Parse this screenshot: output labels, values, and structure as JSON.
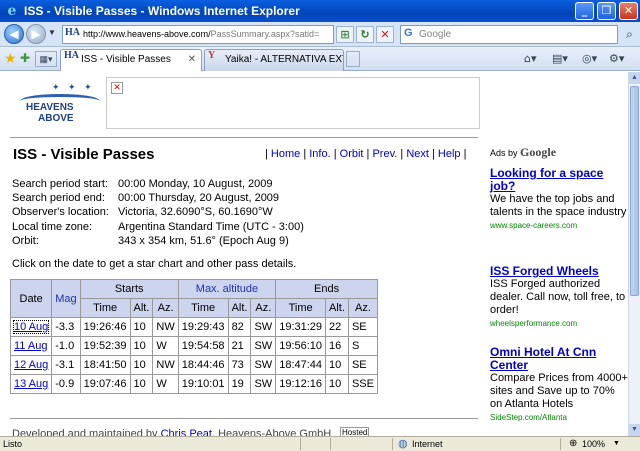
{
  "window": {
    "title": "ISS - Visible Passes - Windows Internet Explorer",
    "minimize": "_",
    "maximize": "❐",
    "close": "✕"
  },
  "address_bar": {
    "url_host": "http://www.heavens-above.com/",
    "url_rest": "PassSummary.aspx?satid=",
    "favicon": "HA",
    "search_placeholder": "Google"
  },
  "tabs": [
    {
      "label": "ISS - Visible Passes",
      "favicon": "HA",
      "active": true
    },
    {
      "label": "Yaika! - ALTERNATIVA EXTR...",
      "favicon": "Y",
      "active": false
    }
  ],
  "logo": {
    "line1": "HEAVENS",
    "line2": "ABOVE",
    "stars": "✦ ✦ ✦"
  },
  "page": {
    "title": "ISS - Visible Passes",
    "top_links": [
      "Home",
      "Info.",
      "Orbit",
      "Prev.",
      "Next",
      "Help"
    ],
    "info": [
      {
        "label": "Search period start:",
        "value": "00:00 Monday, 10 August, 2009"
      },
      {
        "label": "Search period end:",
        "value": "00:00 Thursday, 20 August, 2009"
      },
      {
        "label": "Observer's location:",
        "value": "Victoria, 32.6090°S, 60.1690°W"
      },
      {
        "label": "Local time zone:",
        "value": "Argentina Standard Time (UTC - 3:00)"
      },
      {
        "label": "Orbit:",
        "value": "343 x 354 km, 51.6° (Epoch Aug 9)"
      }
    ],
    "instructions": "Click on the date to get a star chart and other pass details.",
    "table": {
      "group_headers": {
        "date": "Date",
        "mag": "Mag",
        "starts": "Starts",
        "max": "Max. altitude",
        "ends": "Ends"
      },
      "sub_headers": [
        "Time",
        "Alt.",
        "Az.",
        "Time",
        "Alt.",
        "Az.",
        "Time",
        "Alt.",
        "Az."
      ],
      "rows": [
        {
          "date": "10 Aug",
          "mag": "-3.3",
          "s_time": "19:26:46",
          "s_alt": "10",
          "s_az": "NW",
          "m_time": "19:29:43",
          "m_alt": "82",
          "m_az": "SW",
          "e_time": "19:31:29",
          "e_alt": "22",
          "e_az": "SE"
        },
        {
          "date": "11 Aug",
          "mag": "-1.0",
          "s_time": "19:52:39",
          "s_alt": "10",
          "s_az": "W",
          "m_time": "19:54:58",
          "m_alt": "21",
          "m_az": "SW",
          "e_time": "19:56:10",
          "e_alt": "16",
          "e_az": "S"
        },
        {
          "date": "12 Aug",
          "mag": "-3.1",
          "s_time": "18:41:50",
          "s_alt": "10",
          "s_az": "NW",
          "m_time": "18:44:46",
          "m_alt": "73",
          "m_az": "SW",
          "e_time": "18:47:44",
          "e_alt": "10",
          "e_az": "SE"
        },
        {
          "date": "13 Aug",
          "mag": "-0.9",
          "s_time": "19:07:46",
          "s_alt": "10",
          "s_az": "W",
          "m_time": "19:10:01",
          "m_alt": "19",
          "m_az": "SW",
          "e_time": "19:12:16",
          "e_alt": "10",
          "e_az": "SSE"
        }
      ]
    },
    "footer_prefix": "Developed and maintained by ",
    "footer_link": "Chris Peat",
    "footer_suffix": ", Heavens-Above GmbH",
    "hosted": "Hosted"
  },
  "ads": {
    "header_prefix": "Ads by",
    "header_brand": "Google",
    "items": [
      {
        "title": "Looking for a space job?",
        "body": "We have the top jobs and talents in the space industry",
        "url": "www.space-careers.com"
      },
      {
        "title": "ISS Forged Wheels",
        "body": "ISS Forged authorized dealer. Call now, toll free, to order!",
        "url": "wheelsperformance.com"
      },
      {
        "title": "Omni Hotel At Cnn Center",
        "body": "Compare Prices from 4000+ sites and Save up to 70% on Atlanta Hotels",
        "url": "SideStep.com/Atlanta"
      }
    ]
  },
  "status": {
    "text": "Listo",
    "zone": "Internet",
    "zoom": "100%"
  }
}
